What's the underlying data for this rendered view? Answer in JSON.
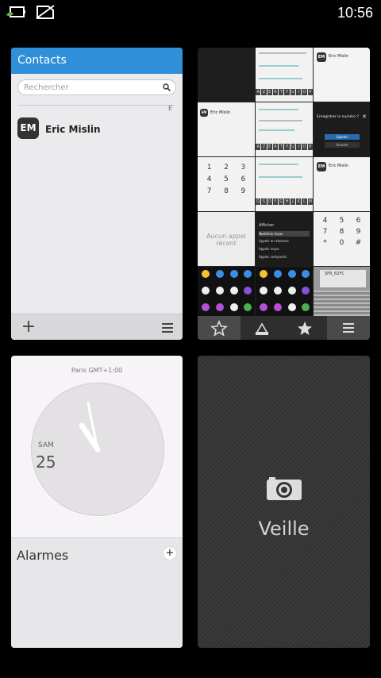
{
  "status_bar": {
    "time": "10:56"
  },
  "contacts_app": {
    "title": "Contacts",
    "search_placeholder": "Rechercher",
    "index_letter": "E",
    "contacts": [
      {
        "initials": "EM",
        "name": "Eric Mislin"
      }
    ],
    "toolbar": {
      "add": "+"
    }
  },
  "phone_app": {
    "caller_initials": "EM",
    "caller_name": "Eric Mislin",
    "save_prompt": "Enregistrer le numéro ?",
    "save_button": "Ajouter",
    "cancel_button": "Annuler",
    "dial_keys": [
      "1",
      "2",
      "3",
      "4",
      "5",
      "6",
      "7",
      "8",
      "9",
      "*",
      "0",
      "#"
    ],
    "no_calls": "Aucun appel récent",
    "filter_title": "Afficher",
    "filter_options": [
      "Numéros reçus",
      "Appels en absence",
      "Appels reçus",
      "Appels composés"
    ],
    "keyboard_row1": [
      "A",
      "Z",
      "E",
      "R",
      "T",
      "Y",
      "U",
      "I",
      "O",
      "P"
    ],
    "keyboard_row2": [
      "Q",
      "S",
      "D",
      "F",
      "G",
      "H",
      "J",
      "K",
      "L",
      "M"
    ],
    "wifi_label": "SFR_B2FC"
  },
  "clock_app": {
    "city": "Paris GMT+1:00",
    "day": "SAM",
    "date": "25",
    "alarms_title": "Alarmes",
    "add_alarm": "+"
  },
  "camera_app": {
    "label": "Veille"
  }
}
